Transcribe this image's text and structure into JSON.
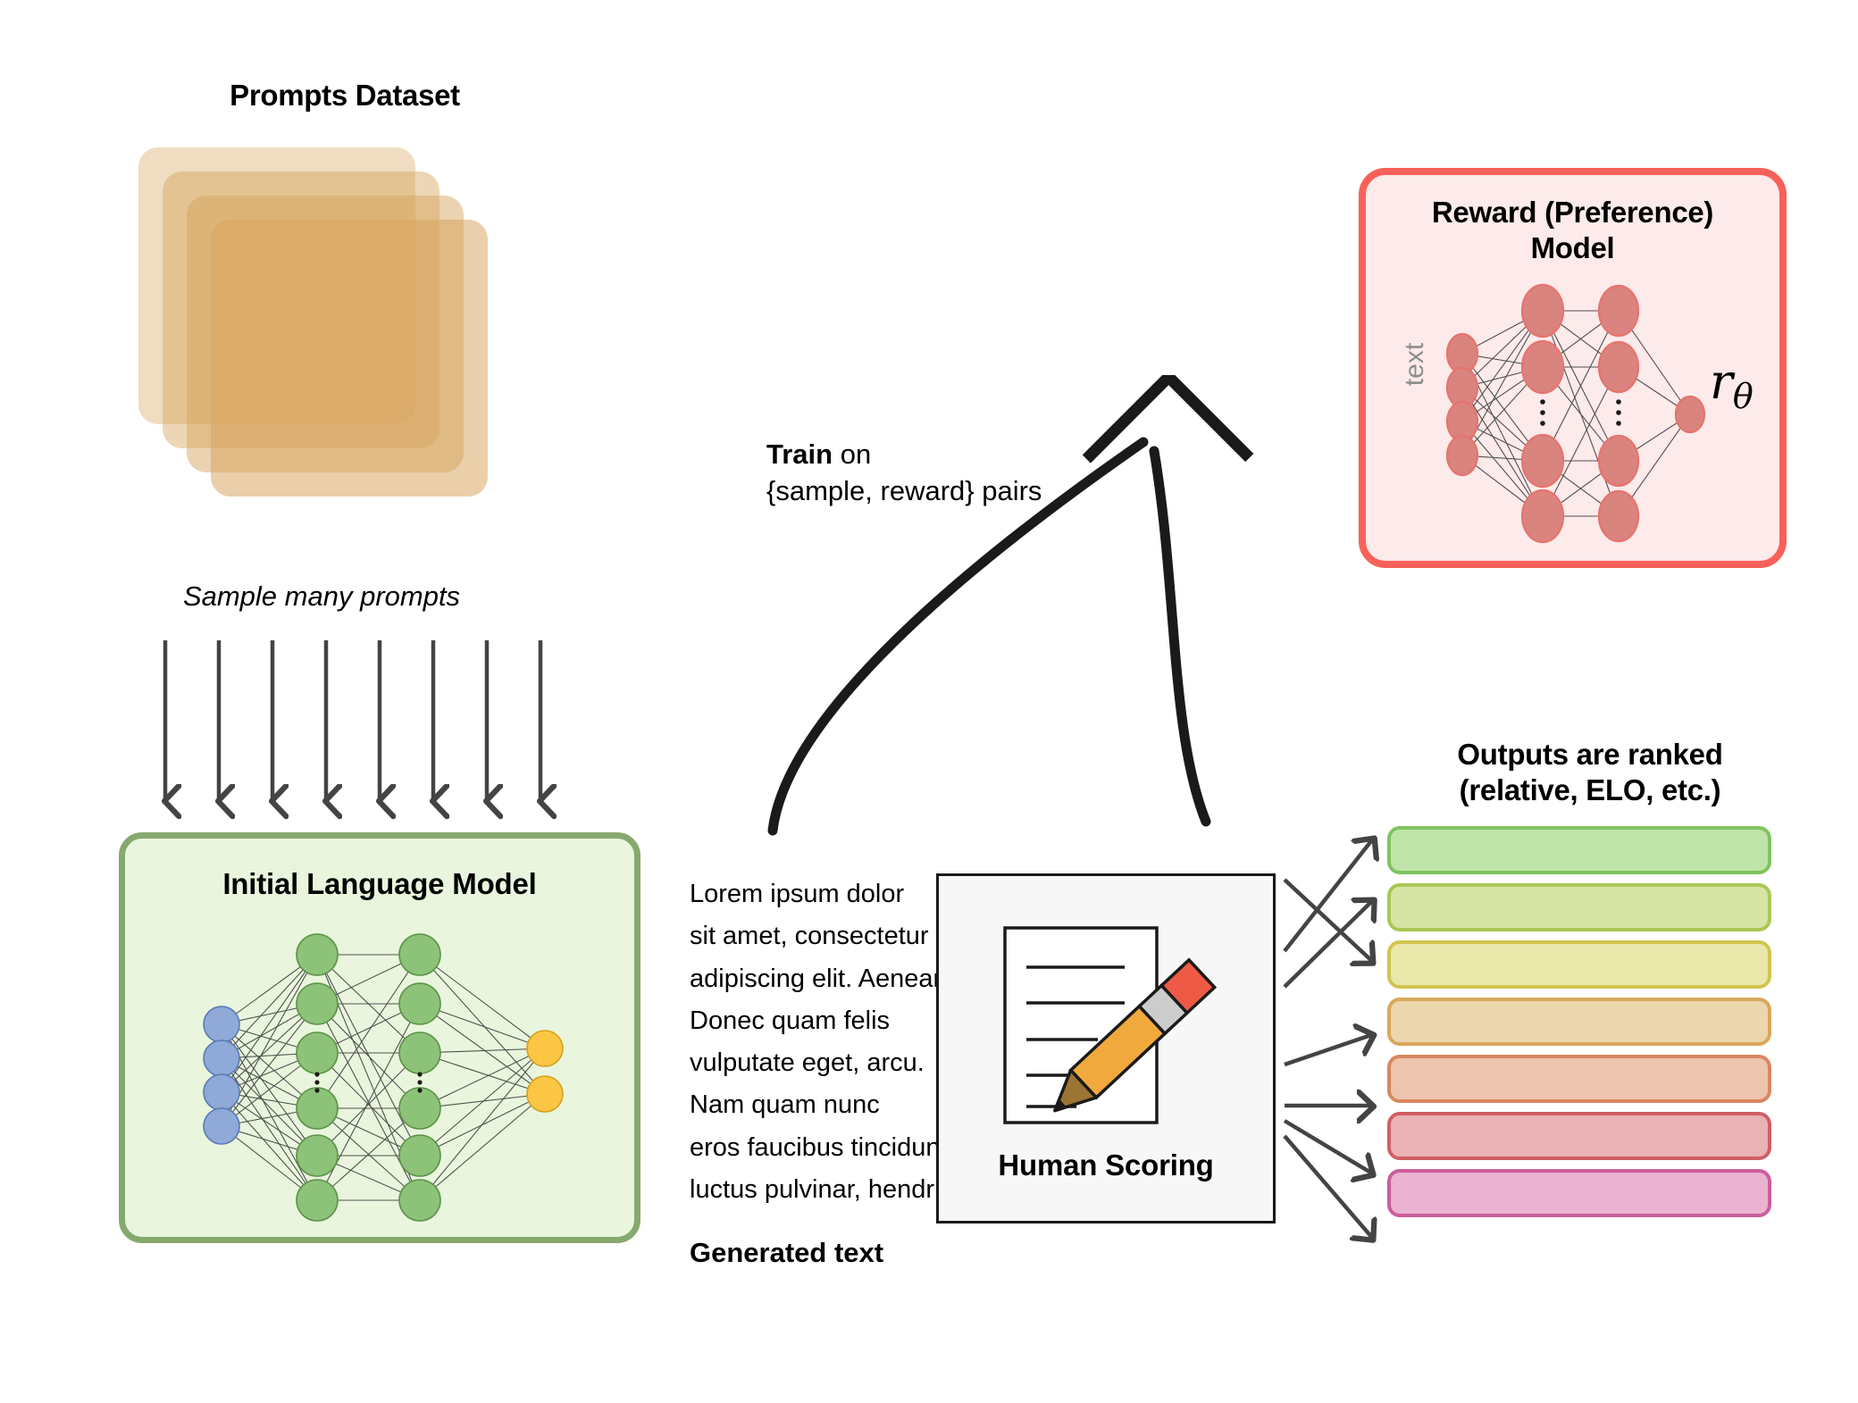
{
  "prompts": {
    "title": "Prompts Dataset",
    "sheet_color": "#d6a35c",
    "sheet_count": 4,
    "caption": "Sample many prompts",
    "arrow_count": 8,
    "arrow_color": "#444444"
  },
  "initial_model": {
    "title": "Initial Language Model",
    "fill": "#e9f6dd",
    "border": "#87a96f",
    "network": {
      "input_nodes": 4,
      "input_color": "#8fa9d8",
      "hidden_layers": 2,
      "hidden_nodes_per_layer": 6,
      "hidden_color": "#8cc379",
      "hidden_ellipsis": true,
      "output_nodes": 2,
      "output_color": "#fbc644",
      "edge_color": "#3f3f3f"
    }
  },
  "train_arrow": {
    "line1_bold": "Train",
    "line1_rest": " on",
    "line2": "{sample, reward} pairs",
    "stroke": "#1a1a1a"
  },
  "reward_model": {
    "title": "Reward (Preference)\nModel",
    "title_line1": "Reward (Preference)",
    "title_line2": "Model",
    "fill": "#fdeaea",
    "border": "#f8615a",
    "input_label": "text",
    "input_label_color": "#8d8d8d",
    "output_symbol": "r",
    "output_subscript": "θ",
    "network": {
      "input_nodes": 4,
      "hidden_layers": 2,
      "hidden_nodes_per_layer": 4,
      "hidden_ellipsis": true,
      "output_nodes": 1,
      "node_color": "#d9847f",
      "node_border": "#e8736d",
      "edge_color": "#3f3f3f"
    }
  },
  "generated": {
    "label": "Generated text",
    "lines": [
      "Lorem ipsum dolor",
      "sit amet, consectetur",
      "adipiscing elit. Aenean",
      "Donec quam felis",
      "vulputate eget, arcu.",
      "Nam quam nunc",
      "eros faucibus tincidunt",
      "luctus pulvinar, hendr"
    ]
  },
  "human_scoring": {
    "label": "Human Scoring",
    "card_fill": "#f7f7f7",
    "card_border": "#1a1a1a",
    "icon": {
      "name": "document-with-pencil-icon",
      "paper_lines": 5,
      "pencil_body_color": "#f0a93c",
      "pencil_eraser_color": "#ee5a45",
      "pencil_ferrule_color": "#cccccc",
      "pencil_wood_color": "#9c7433",
      "pencil_tip_color": "#1a1a1a"
    }
  },
  "outputs": {
    "title_line1": "Outputs are ranked",
    "title_line2": "(relative, ELO, etc.)",
    "arrow_count": 7,
    "arrow_color": "#444444",
    "bars": [
      {
        "fill": "#bfe3a8",
        "border": "#7ec45f"
      },
      {
        "fill": "#d7e4a5",
        "border": "#aac755"
      },
      {
        "fill": "#eae7ab",
        "border": "#d2c44f"
      },
      {
        "fill": "#ecd6ad",
        "border": "#d9a85a"
      },
      {
        "fill": "#edc4ae",
        "border": "#d98761"
      },
      {
        "fill": "#e9b2b5",
        "border": "#d05f66"
      },
      {
        "fill": "#eab3d0",
        "border": "#cc5d9b"
      }
    ]
  }
}
